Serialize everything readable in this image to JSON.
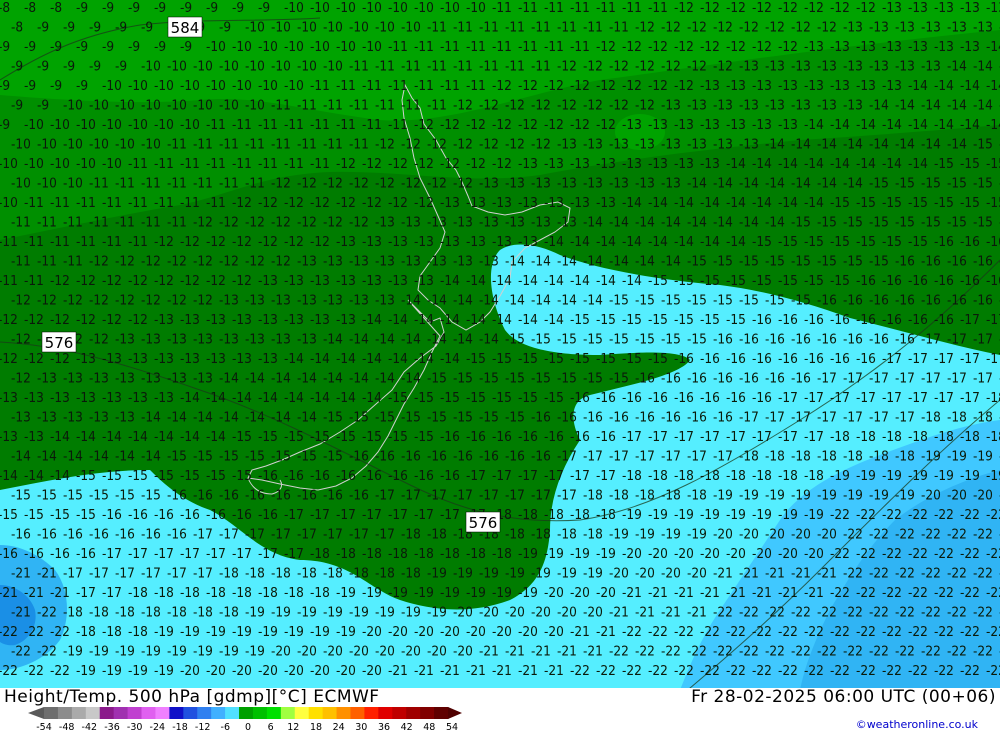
{
  "map": {
    "title": "Height/Temp. 500 hPa [gdmp][°C] ECMWF",
    "valid_time": "Fr 28-02-2025 06:00 UTC (00+06)",
    "credit": "©weatheronline.co.uk",
    "height_contour_labels": [
      "584",
      "576",
      "576"
    ],
    "scale_labels": [
      "-54",
      "-48",
      "-42",
      "-36",
      "-30",
      "-24",
      "-18",
      "-12",
      "-6",
      "0",
      "6",
      "12",
      "18",
      "24",
      "30",
      "36",
      "42",
      "48",
      "54"
    ],
    "scale_colors": [
      "#6e6e6e",
      "#8c8c8c",
      "#aaaaaa",
      "#c8c8c8",
      "#8b1a8b",
      "#a030b0",
      "#c040d0",
      "#e060f0",
      "#f080ff",
      "#1010c8",
      "#2050e0",
      "#3080f0",
      "#40b0ff",
      "#50e0ff",
      "#00a000",
      "#00c000",
      "#00e000",
      "#a0ff40",
      "#ffff40",
      "#ffe000",
      "#ffc000",
      "#ff9000",
      "#ff6000",
      "#ff2000",
      "#e00000",
      "#c00000",
      "#a00000",
      "#800000",
      "#600000"
    ],
    "colors": {
      "t_minus_8_to_11": "#00a300",
      "t_minus_11_to_14": "#008c00",
      "t_minus_14_plus": "#006e00",
      "t_minus_15_to_17": "#55eeff",
      "t_minus_17_to_19": "#40ccff",
      "t_minus_19_to_24": "#1aa0ee",
      "coast": "#d0d0d0"
    }
  }
}
